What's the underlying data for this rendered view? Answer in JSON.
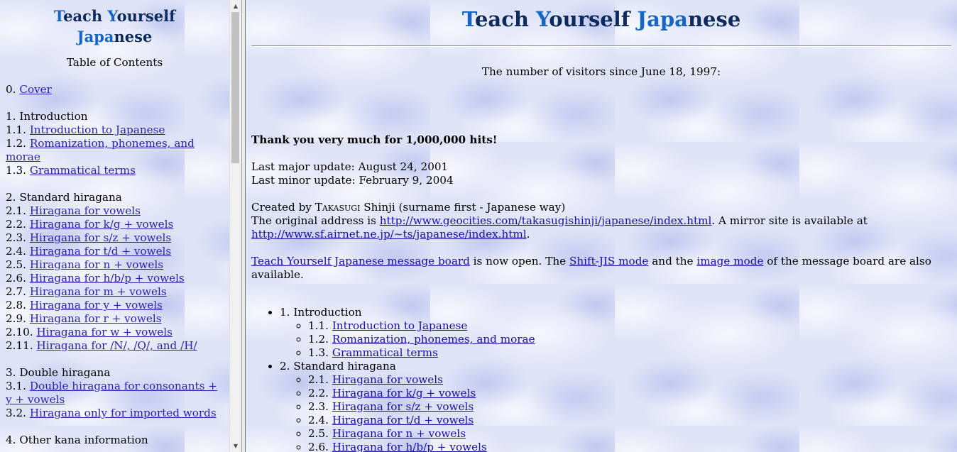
{
  "title": {
    "word1_initial": "T",
    "word1_rest": "each",
    "word2_initial": "Y",
    "word2_rest": "ourself",
    "word3_initial": "J",
    "word3_mid": "apa",
    "word3_rest": "nese"
  },
  "sidebar": {
    "toc_heading": "Table of Contents",
    "groups": [
      {
        "items": [
          {
            "num": "0.",
            "link": "Cover"
          }
        ]
      },
      {
        "header": "1. Introduction",
        "items": [
          {
            "num": "1.1.",
            "link": "Introduction to Japanese"
          },
          {
            "num": "1.2.",
            "link": "Romanization, phonemes, and morae"
          },
          {
            "num": "1.3.",
            "link": "Grammatical terms"
          }
        ]
      },
      {
        "header": "2. Standard hiragana",
        "items": [
          {
            "num": "2.1.",
            "link": "Hiragana for vowels"
          },
          {
            "num": "2.2.",
            "link": "Hiragana for k/g + vowels"
          },
          {
            "num": "2.3.",
            "link": "Hiragana for s/z + vowels"
          },
          {
            "num": "2.4.",
            "link": "Hiragana for t/d + vowels"
          },
          {
            "num": "2.5.",
            "link": "Hiragana for n + vowels"
          },
          {
            "num": "2.6.",
            "link": "Hiragana for h/b/p + vowels"
          },
          {
            "num": "2.7.",
            "link": "Hiragana for m + vowels"
          },
          {
            "num": "2.8.",
            "link": "Hiragana for y + vowels"
          },
          {
            "num": "2.9.",
            "link": "Hiragana for r + vowels"
          },
          {
            "num": "2.10.",
            "link": "Hiragana for w + vowels"
          },
          {
            "num": "2.11.",
            "link": "Hiragana for /N/, /Q/, and /H/"
          }
        ]
      },
      {
        "header": "3. Double hiragana",
        "items": [
          {
            "num": "3.1.",
            "link": "Double hiragana for consonants + y + vowels"
          },
          {
            "num": "3.2.",
            "link": "Hiragana only for imported words"
          }
        ]
      },
      {
        "header": "4. Other kana information",
        "items": []
      }
    ]
  },
  "main": {
    "visitors_text": "The number of visitors since June 18, 1997:",
    "thanks_text": "Thank you very much for 1,000,000 hits!",
    "last_major": "Last major update: August 24, 2001",
    "last_minor": "Last minor update: February 9, 2004",
    "created_prefix": "Created by ",
    "author_surname_initial": "T",
    "author_surname_rest": "akasugi",
    "created_suffix": " Shinji (surname first - Japanese way)",
    "original_prefix": "The original address is ",
    "original_url": "http://www.geocities.com/takasugishinji/japanese/index.html",
    "mirror_text": ". A mirror site is available at",
    "mirror_url": "http://www.sf.airnet.ne.jp/~ts/japanese/index.html",
    "mirror_end": ".",
    "board_link": "Teach Yourself Japanese message board",
    "board_text1": " is now open. The ",
    "shiftjis_link": "Shift-JIS mode",
    "board_text2": " and the ",
    "image_link": "image mode",
    "board_text3": " of the message board are also available.",
    "outline": [
      {
        "header": "1. Introduction",
        "items": [
          {
            "num": "1.1.",
            "link": "Introduction to Japanese"
          },
          {
            "num": "1.2.",
            "link": "Romanization, phonemes, and morae"
          },
          {
            "num": "1.3.",
            "link": "Grammatical terms"
          }
        ]
      },
      {
        "header": "2. Standard hiragana",
        "items": [
          {
            "num": "2.1.",
            "link": "Hiragana for vowels"
          },
          {
            "num": "2.2.",
            "link": "Hiragana for k/g + vowels"
          },
          {
            "num": "2.3.",
            "link": "Hiragana for s/z + vowels"
          },
          {
            "num": "2.4.",
            "link": "Hiragana for t/d + vowels"
          },
          {
            "num": "2.5.",
            "link": "Hiragana for n + vowels"
          },
          {
            "num": "2.6.",
            "link": "Hiragana for h/b/p + vowels"
          }
        ]
      }
    ]
  },
  "colors": {
    "title_blue": "#1565c8",
    "title_navy": "#0d2a5c",
    "link": "#1a0dab"
  }
}
